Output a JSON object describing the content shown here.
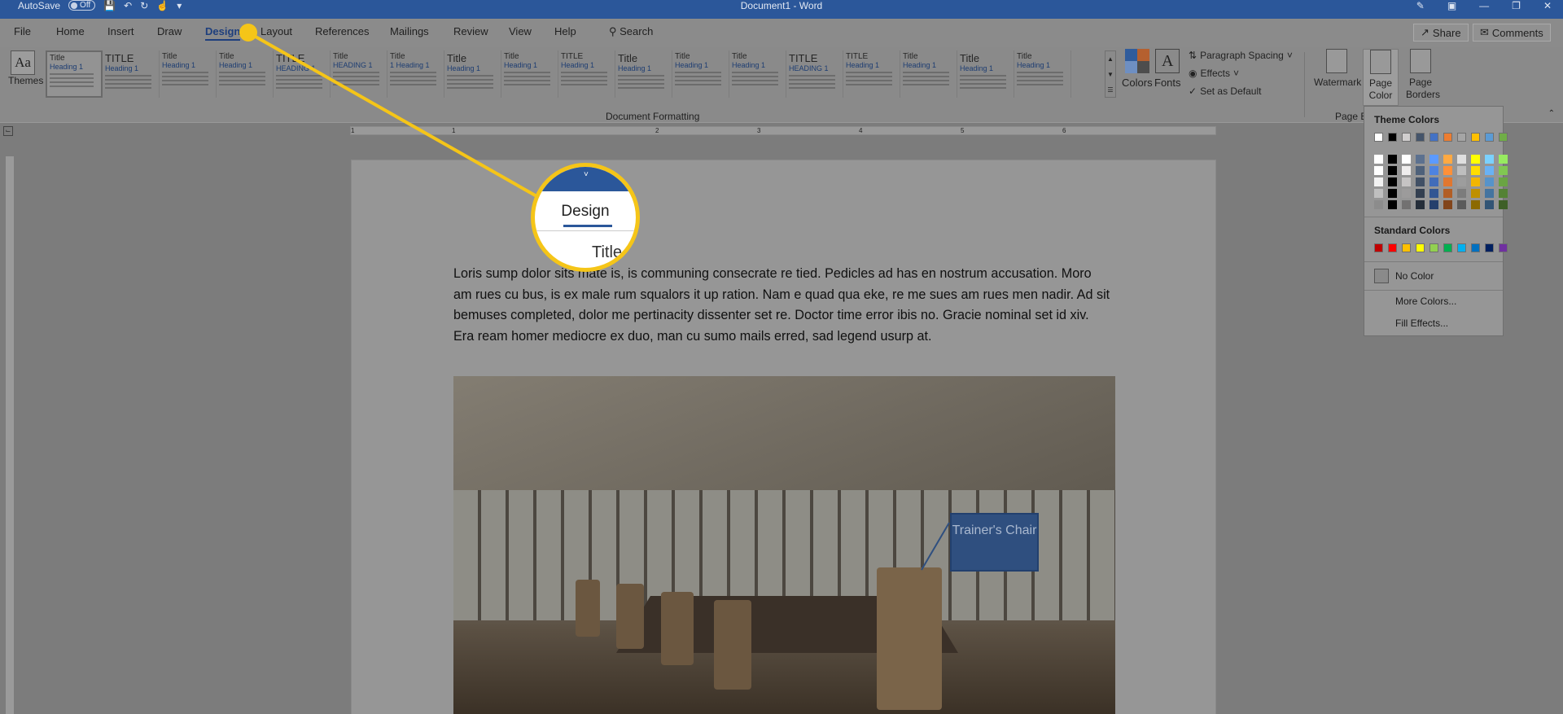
{
  "titlebar": {
    "autosave": "AutoSave",
    "autosave_state": "Off",
    "doc_title": "Document1  -  Word"
  },
  "tabs": [
    "File",
    "Home",
    "Insert",
    "Draw",
    "Design",
    "Layout",
    "References",
    "Mailings",
    "Review",
    "View",
    "Help"
  ],
  "active_tab": "Design",
  "search": "Search",
  "share": "Share",
  "comments": "Comments",
  "ribbon": {
    "themes": "Themes",
    "styles": [
      {
        "title": "Title",
        "heading": "Heading 1"
      },
      {
        "title": "TITLE",
        "heading": "Heading 1"
      },
      {
        "title": "Title",
        "heading": "Heading 1"
      },
      {
        "title": "Title",
        "heading": "Heading 1"
      },
      {
        "title": "TITLE",
        "heading": "HEADING 1"
      },
      {
        "title": "Title",
        "heading": "HEADING 1"
      },
      {
        "title": "Title",
        "heading": "1  Heading 1"
      },
      {
        "title": "Title",
        "heading": "Heading 1"
      },
      {
        "title": "Title",
        "heading": "Heading 1"
      },
      {
        "title": "TITLE",
        "heading": "Heading 1"
      },
      {
        "title": "Title",
        "heading": "Heading 1"
      },
      {
        "title": "Title",
        "heading": "Heading 1"
      },
      {
        "title": "Title",
        "heading": "Heading 1"
      },
      {
        "title": "TITLE",
        "heading": "HEADING 1"
      },
      {
        "title": "TITLE",
        "heading": "Heading 1"
      },
      {
        "title": "Title",
        "heading": "Heading 1"
      },
      {
        "title": "Title",
        "heading": "Heading 1"
      },
      {
        "title": "Title",
        "heading": "Heading 1"
      }
    ],
    "group_label": "Document Formatting",
    "colors": "Colors",
    "fonts": "Fonts",
    "paragraph_spacing": "Paragraph Spacing",
    "effects": "Effects",
    "set_default": "Set as Default",
    "watermark": "Watermark",
    "page_color": "Page Color",
    "page_borders": "Page Borders",
    "page_bg_label": "Page B"
  },
  "ruler_marks": [
    "1",
    "1",
    "2",
    "3",
    "4",
    "5",
    "6"
  ],
  "document": {
    "paragraph": "Loris sump dolor sits mate is, is communing consecrate re tied. Pedicles ad has en nostrum accusation. Moro am rues cu bus, is ex male rum squalors it up ration. Nam e quad qua eke, re me sues am rues men nadir. Ad sit bemuses completed, dolor me pertinacity dissenter set re. Doctor time error ibis no. Gracie nominal set id xiv. Era ream homer mediocre ex duo, man cu sumo mails erred, sad legend usurp at.",
    "callout": "Trainer's Chair"
  },
  "dropdown": {
    "theme_colors": "Theme Colors",
    "standard_colors": "Standard Colors",
    "no_color": "No Color",
    "more_colors": "More Colors...",
    "fill_effects": "Fill Effects...",
    "theme_row": [
      "#ffffff",
      "#000000",
      "#d0cece",
      "#44546a",
      "#4472c4",
      "#ed7d31",
      "#a5a5a5",
      "#ffc000",
      "#5b9bd5",
      "#70ad47"
    ],
    "standard_row": [
      "#c00000",
      "#ff0000",
      "#ffc000",
      "#ffff00",
      "#92d050",
      "#00b050",
      "#00b0f0",
      "#0070c0",
      "#002060",
      "#7030a0"
    ]
  },
  "zoom": {
    "label": "Design",
    "sub": "Title"
  },
  "accent": "#f5c518"
}
